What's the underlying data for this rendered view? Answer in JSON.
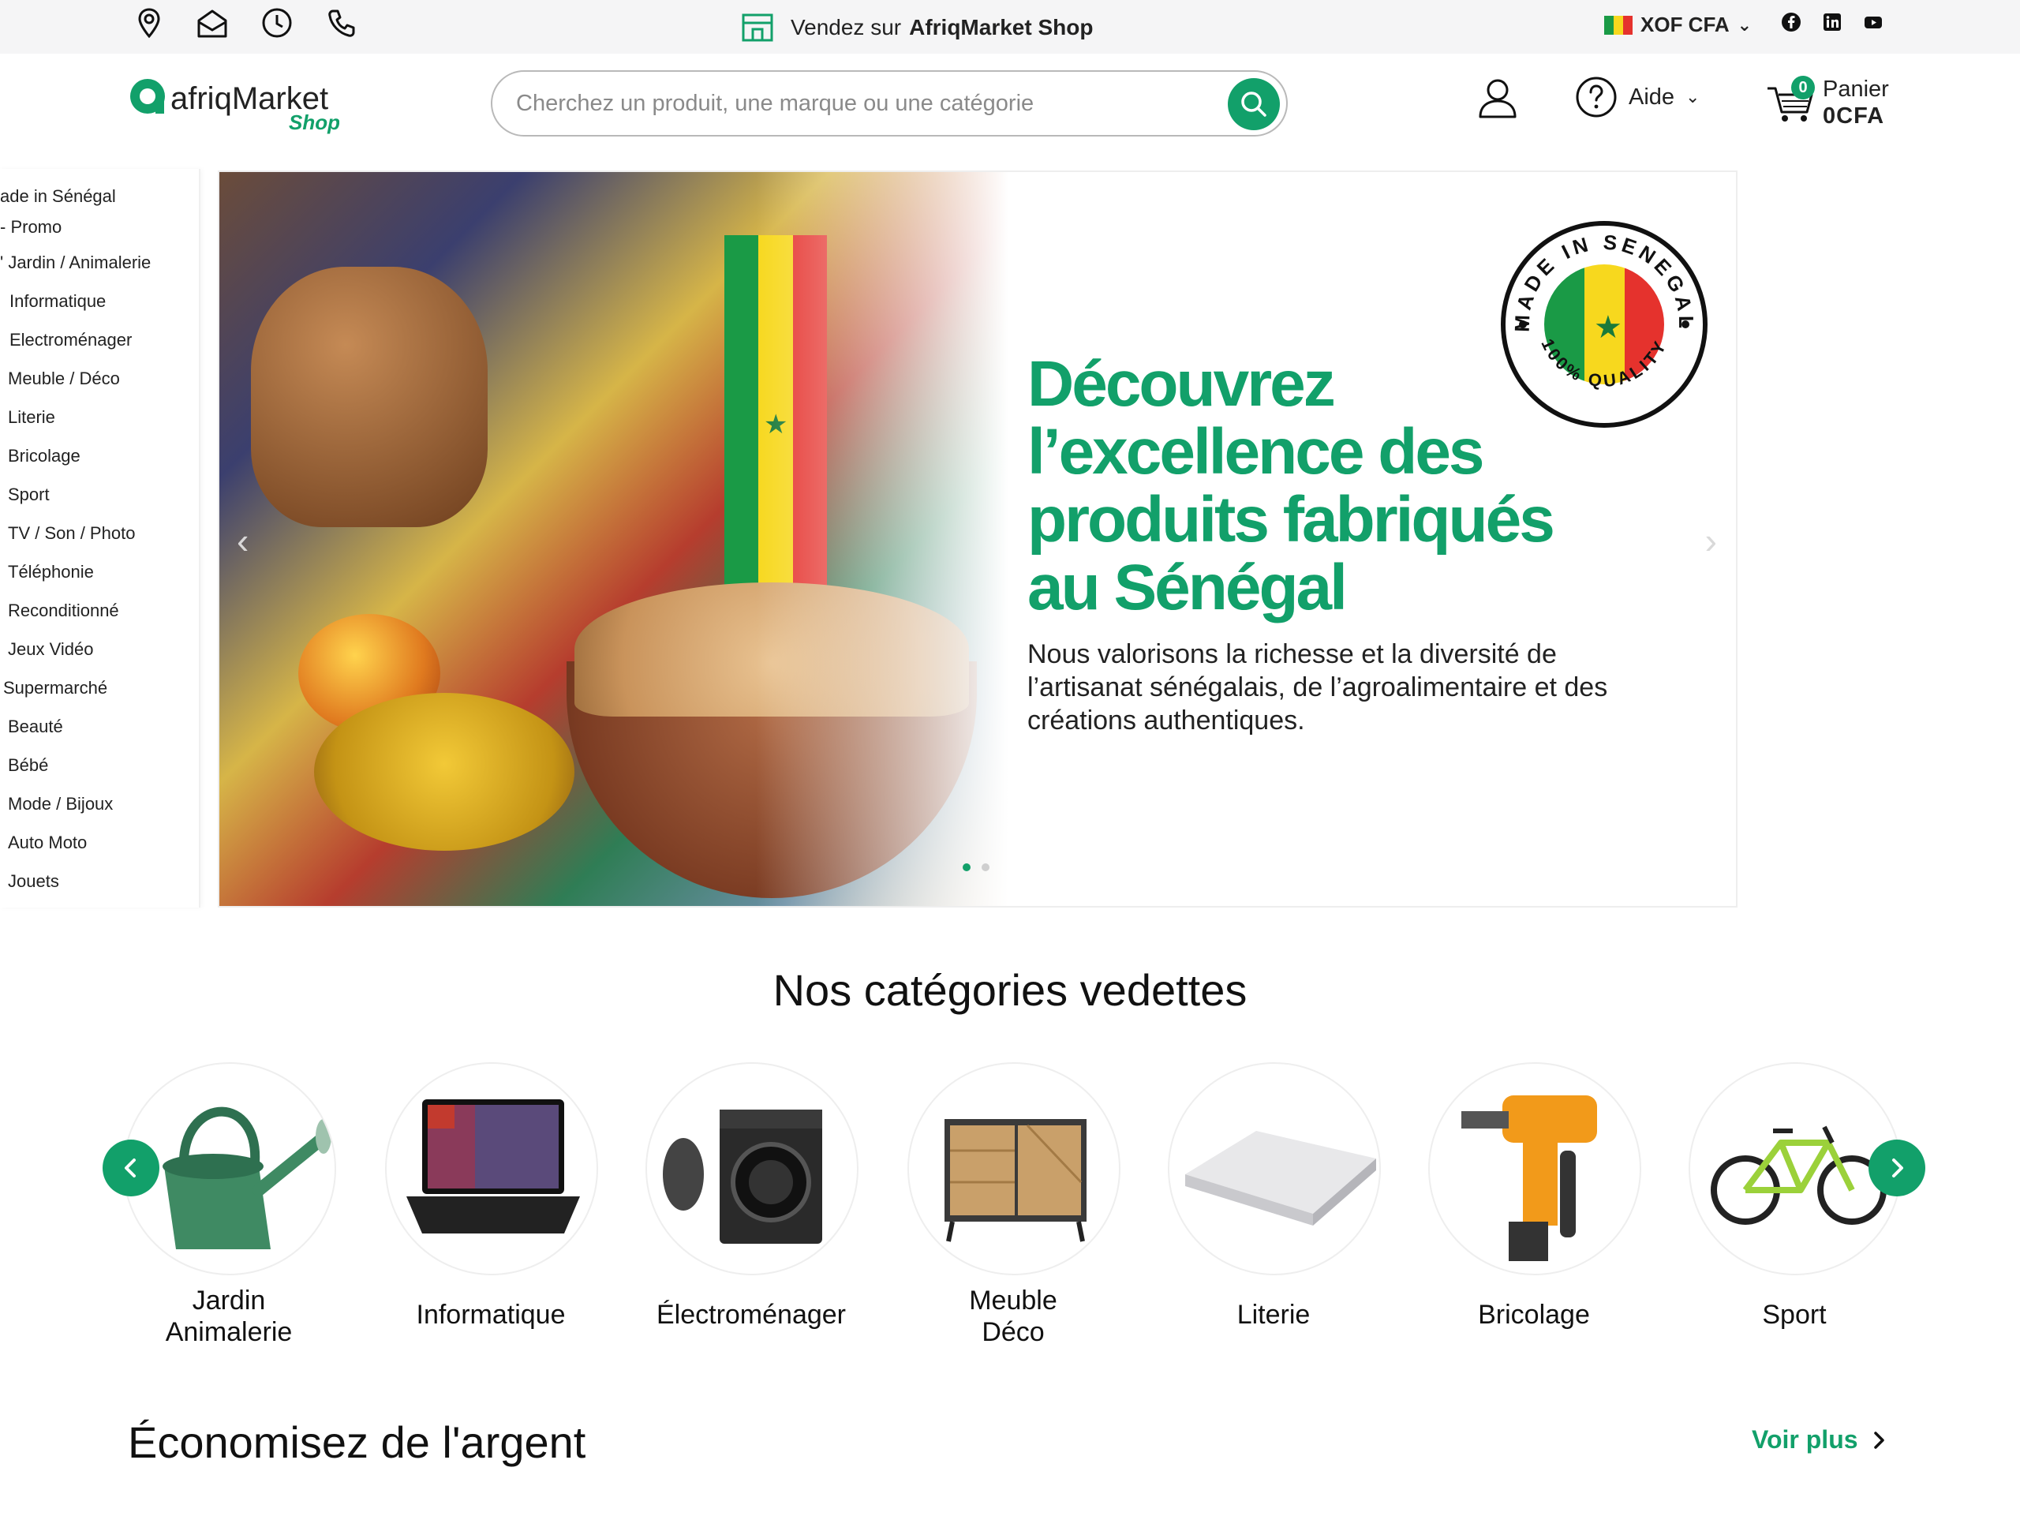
{
  "topbar": {
    "icons": [
      "location-pin-icon",
      "mail-icon",
      "clock-icon",
      "phone-icon"
    ],
    "sell_prefix": "Vendez sur",
    "sell_brand": "AfriqMarket Shop",
    "currency": "XOF CFA",
    "social": [
      "facebook-icon",
      "linkedin-icon",
      "youtube-icon"
    ]
  },
  "header": {
    "logo_text": "afriqMarket",
    "logo_sub": "Shop",
    "search_placeholder": "Cherchez un produit, une marque ou une catégorie",
    "help_label": "Aide",
    "cart_count": "0",
    "cart_label": "Panier",
    "cart_amount": "0CFA"
  },
  "sidebar": {
    "items": [
      "ade in Sénégal",
      "- Promo",
      "' Jardin / Animalerie",
      "Informatique",
      "Electroménager",
      "Meuble / Déco",
      "Literie",
      "Bricolage",
      "Sport",
      "TV / Son / Photo",
      "Téléphonie",
      "Reconditionné",
      "Jeux Vidéo",
      "Supermarché",
      "Beauté",
      "Bébé",
      "Mode / Bijoux",
      "Auto Moto",
      "Jouets"
    ]
  },
  "banner": {
    "headline": "Découvrez l’excellence des produits fabriqués au Sénégal",
    "subline": "Nous valorisons la richesse et la diversité de l’artisanat sénégalais, de l’agroalimentaire et des créations authentiques.",
    "badge_top": "MADE IN SENEGAL",
    "badge_bottom": "100% QUALITY",
    "slides": 2,
    "active_slide": 1
  },
  "featured": {
    "title": "Nos catégories vedettes",
    "categories": [
      {
        "line1": "Jardin",
        "line2": "Animalerie"
      },
      {
        "line1": "Informatique",
        "line2": ""
      },
      {
        "line1": "Électroménager",
        "line2": ""
      },
      {
        "line1": "Meuble",
        "line2": "Déco"
      },
      {
        "line1": "Literie",
        "line2": ""
      },
      {
        "line1": "Bricolage",
        "line2": ""
      },
      {
        "line1": "Sport",
        "line2": ""
      }
    ]
  },
  "savings": {
    "title": "Économisez de l'argent",
    "see_more": "Voir plus"
  },
  "colors": {
    "brand_green": "#12a06a",
    "text_dark": "#111111",
    "topbar_bg": "#f5f5f6"
  }
}
